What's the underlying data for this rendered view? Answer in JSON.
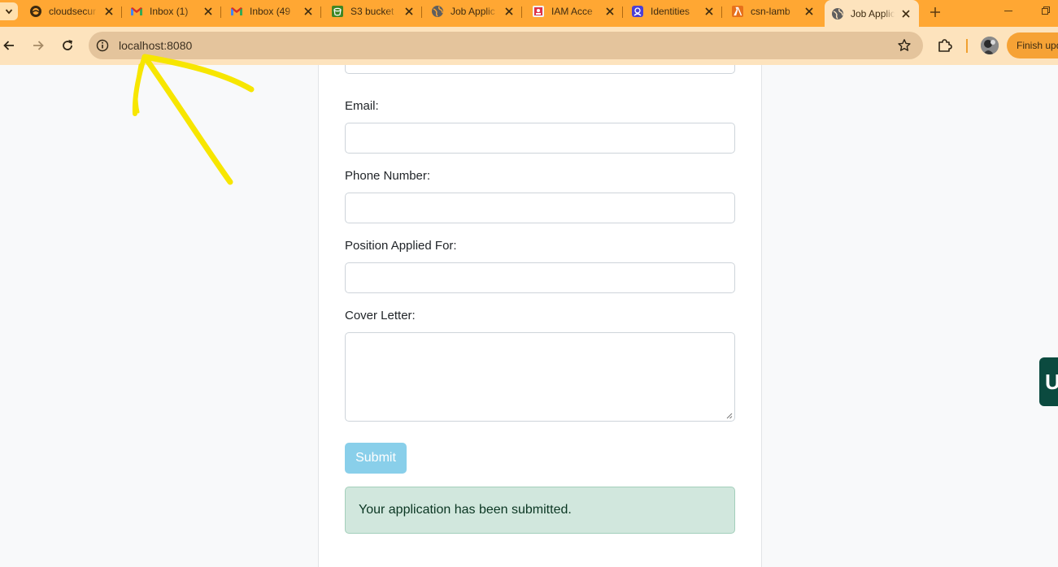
{
  "tabs": [
    {
      "title": "cloudsecur",
      "icon": "cloud-icon"
    },
    {
      "title": "Inbox (1)",
      "icon": "gmail-icon"
    },
    {
      "title": "Inbox (49",
      "icon": "gmail-icon"
    },
    {
      "title": "S3 bucket",
      "icon": "s3-icon"
    },
    {
      "title": "Job Applic",
      "icon": "globe-icon"
    },
    {
      "title": "IAM Acce",
      "icon": "iam-icon"
    },
    {
      "title": "Identities",
      "icon": "identity-icon"
    },
    {
      "title": "csn-lamb",
      "icon": "lambda-icon"
    },
    {
      "title": "Job Applic",
      "icon": "globe-icon",
      "active": true
    }
  ],
  "toolbar": {
    "url": "localhost:8080",
    "finish_update_label": "Finish update"
  },
  "form": {
    "email_label": "Email:",
    "phone_label": "Phone Number:",
    "position_label": "Position Applied For:",
    "cover_letter_label": "Cover Letter:",
    "submit_label": "Submit",
    "success_message": "Your application has been submitted."
  },
  "side_widget": {
    "glyph": "U"
  },
  "colors": {
    "tab_strip": "#ffa733",
    "toolbar": "#fde3bd",
    "submit_button": "#89cfea",
    "alert_background": "#d1e7dd",
    "annotation_arrow": "#f7e600"
  }
}
